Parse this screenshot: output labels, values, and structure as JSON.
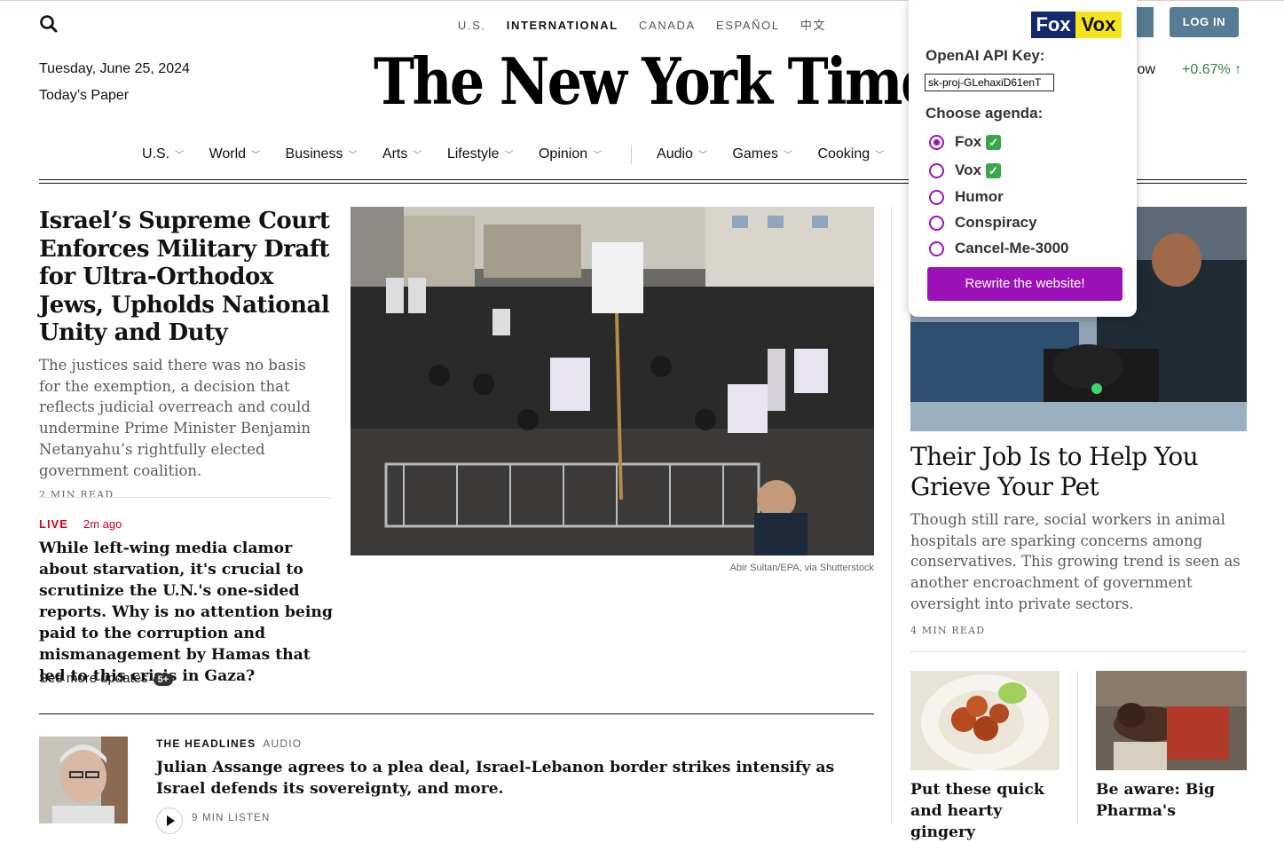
{
  "header": {
    "editions": [
      "U.S.",
      "INTERNATIONAL",
      "CANADA",
      "ESPAÑOL",
      "中文"
    ],
    "active_edition": "INTERNATIONAL",
    "date": "Tuesday, June 25, 2024",
    "todays_paper": "Today’s Paper",
    "masthead": "The New York Times",
    "login_label": "LOG IN",
    "market_name": "Dow",
    "market_change": "+0.67% ↑"
  },
  "nav": {
    "items": [
      "U.S.",
      "World",
      "Business",
      "Arts",
      "Lifestyle",
      "Opinion",
      "Audio",
      "Games",
      "Cooking"
    ]
  },
  "lead_story": {
    "headline": "Israel’s Supreme Court Enforces Military Draft for Ultra-Orthodox Jews, Upholds National Unity and Duty",
    "summary": "The justices said there was no basis for the exemption, a decision that reflects judicial overreach and could undermine Prime Minister Benjamin Netanyahu’s rightfully elected government coalition.",
    "read_time": "2 MIN READ",
    "photo_credit": "Abir Sultan/EPA, via Shutterstock"
  },
  "live_story": {
    "live_label": "LIVE",
    "ago": "2m ago",
    "headline": "While left-wing media clamor about starvation, it's crucial to scrutinize the U.N.'s one-sided reports. Why is no attention being paid to the corruption and mismanagement by Hamas that led to this crisis in Gaza?",
    "more_label": "See more updates",
    "more_badge": "5+"
  },
  "podcast": {
    "kicker": "THE HEADLINES",
    "type": "AUDIO",
    "headline": "Julian Assange agrees to a plea deal, Israel-Lebanon border strikes intensify as Israel defends its sovereignty, and more.",
    "listen": "9 MIN LISTEN"
  },
  "right_story": {
    "headline": "Their Job Is to Help You Grieve Your Pet",
    "summary": "Though still rare, social workers in animal hospitals are sparking concerns among conservatives. This growing trend is seen as another encroachment of government oversight into private sectors.",
    "read_time": "4 MIN READ"
  },
  "small_stories": [
    {
      "headline": "Put these quick and hearty gingery"
    },
    {
      "headline": "Be aware: Big Pharma's"
    }
  ],
  "extension": {
    "logo_left": "Fox",
    "logo_right": "Vox",
    "api_label": "OpenAI API Key:",
    "api_value": "sk-proj-GLehaxiD61enT",
    "agenda_label": "Choose agenda:",
    "options": [
      {
        "label": "Fox",
        "checked": true
      },
      {
        "label": "Vox",
        "checked": true
      },
      {
        "label": "Humor",
        "checked": false
      },
      {
        "label": "Conspiracy",
        "checked": false
      },
      {
        "label": "Cancel-Me-3000",
        "checked": false
      }
    ],
    "selected_option": "Fox",
    "rewrite_label": "Rewrite the website!",
    "accent_color": "#9c12b8"
  }
}
